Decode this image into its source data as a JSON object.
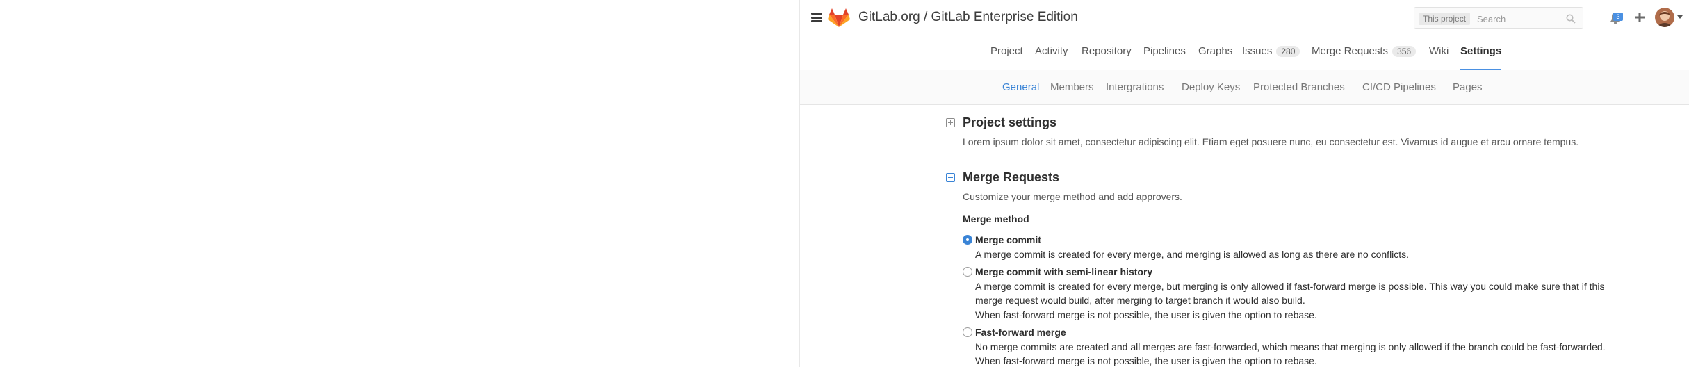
{
  "header": {
    "title": "GitLab.org / GitLab Enterprise Edition",
    "search_scope": "This project",
    "search_placeholder": "Search",
    "notification_count": "3",
    "icons": [
      "menu-icon",
      "gitlab-logo",
      "search-icon",
      "bell-icon",
      "plus-icon",
      "avatar"
    ]
  },
  "project_nav": {
    "items": [
      {
        "label": "Project"
      },
      {
        "label": "Activity"
      },
      {
        "label": "Repository"
      },
      {
        "label": "Pipelines"
      },
      {
        "label": "Graphs"
      },
      {
        "label": "Issues",
        "count": "280"
      },
      {
        "label": "Merge Requests",
        "count": "356"
      },
      {
        "label": "Wiki"
      },
      {
        "label": "Settings",
        "active": true
      }
    ]
  },
  "sub_nav": {
    "items": [
      {
        "label": "General",
        "active": true
      },
      {
        "label": "Members"
      },
      {
        "label": "Intergrations"
      },
      {
        "label": "Deploy Keys"
      },
      {
        "label": "Protected Branches"
      },
      {
        "label": "CI/CD Pipelines"
      },
      {
        "label": "Pages"
      }
    ]
  },
  "sections": {
    "project_settings": {
      "title": "Project settings",
      "description": "Lorem ipsum dolor sit amet, consectetur adipiscing elit. Etiam eget posuere nunc, eu consectetur est. Vivamus id augue et arcu ornare tempus."
    },
    "merge_requests": {
      "title": "Merge Requests",
      "description": "Customize your merge method and add approvers.",
      "merge_method_label": "Merge method",
      "options": [
        {
          "label": "Merge commit",
          "checked": true,
          "help": [
            "A merge commit is created for every merge, and merging is allowed as long as there are no conflicts."
          ]
        },
        {
          "label": "Merge commit with semi-linear history",
          "checked": false,
          "help": [
            "A merge commit is created for every merge, but merging is only allowed if fast-forward merge is possible. This way you could make sure that if this",
            "merge request would build, after merging to target branch it would also build.",
            "When fast-forward merge is not possible, the user is given the option to rebase."
          ]
        },
        {
          "label": "Fast-forward merge",
          "checked": false,
          "help": [
            "No merge commits are created and all merges are fast-forwarded, which means that merging is only allowed if the branch could be fast-forwarded.",
            "When fast-forward merge is not possible, the user is given the option to rebase."
          ]
        }
      ]
    }
  },
  "colors": {
    "accent": "#3a84d6",
    "logo_orange": "#e24329",
    "logo_light": "#fca326",
    "badge_blue": "#4a90e2"
  }
}
